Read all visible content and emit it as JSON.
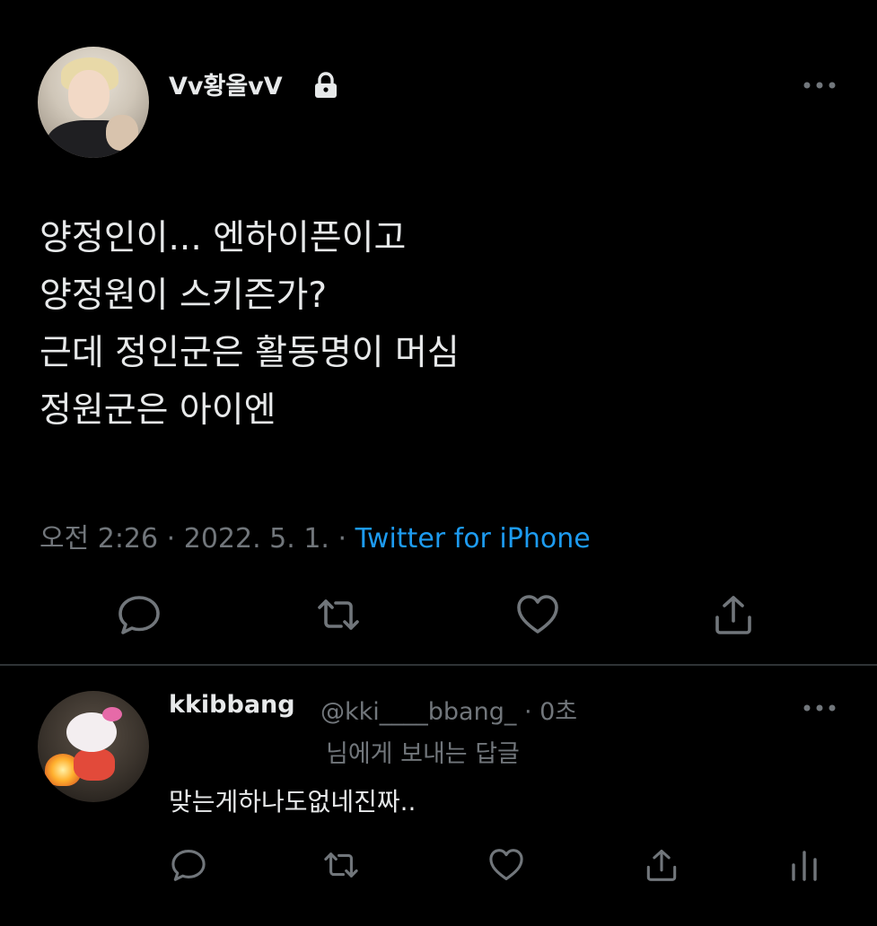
{
  "main_tweet": {
    "display_name": "Vv황올vV",
    "text_lines": [
      "양정인이... 엔하이픈이고",
      "양정원이 스키즌가?",
      "근데 정인군은 활동명이 머심",
      "정원군은 아이엔"
    ],
    "time": "오전 2:26",
    "date": "2022. 5. 1.",
    "source": "Twitter for iPhone",
    "icons": [
      "lock-icon",
      "more-icon",
      "reply-icon",
      "retweet-icon",
      "like-icon",
      "share-icon"
    ]
  },
  "reply_tweet": {
    "display_name": "kkibbang",
    "handle": "@kki____bbang_",
    "time": "0초",
    "replying_to": "님에게 보내는 답글",
    "text": "맞는게하나도없네진짜..",
    "icons": [
      "more-icon",
      "reply-icon",
      "retweet-icon",
      "like-icon",
      "share-icon",
      "analytics-icon"
    ]
  },
  "colors": {
    "background": "#000000",
    "text": "#e7e9ea",
    "secondary": "#71767b",
    "link": "#1d9bf0",
    "divider": "#2f3336"
  }
}
